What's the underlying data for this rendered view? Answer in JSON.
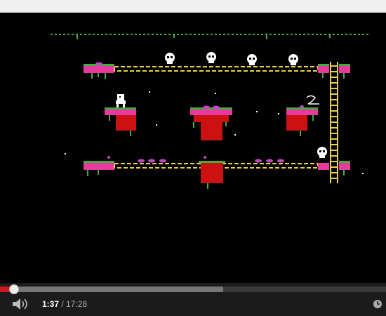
{
  "player": {
    "current_time": "1:37",
    "time_separator": " / ",
    "duration": "17:28",
    "played_fraction": 0.037,
    "buffered_fraction": 0.578
  },
  "icons": {
    "volume": "volume-icon",
    "settings": "settings-clock-icon"
  },
  "colors": {
    "progress_played": "#cc181e",
    "progress_buffered": "#777777",
    "controls_bg": "#1b1b1b",
    "platform_pink": "#e83a9e",
    "block_red": "#cc1111",
    "vine_green": "#3fae3f",
    "girder_yellow": "#e6d24a",
    "skull_white": "#ffffff"
  }
}
